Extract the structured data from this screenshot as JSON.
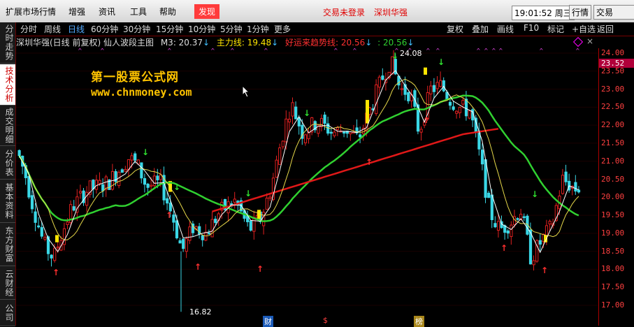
{
  "menubar": {
    "items": [
      "扩展市场行情",
      "增强",
      "资讯",
      "工具",
      "帮助"
    ],
    "active_item": "发现",
    "login_status": "交易未登录",
    "stock_name": "深圳华强",
    "clock": "19:01:52 周三",
    "buttons": [
      "行情",
      "交易"
    ]
  },
  "sidebar": {
    "tabs": [
      "分时走势",
      "技术分析",
      "成交明细",
      "分价表",
      "基本资料",
      "东方财富",
      "云财经",
      "公司"
    ]
  },
  "toolbar": {
    "periods": [
      "分时",
      "周线",
      "日线",
      "60分钟",
      "30分钟",
      "15分钟",
      "10分钟",
      "5分钟",
      "1分钟",
      "更多"
    ],
    "tools": [
      "复权",
      "叠加",
      "画线",
      "F10",
      "标记",
      "+自选",
      "返回"
    ]
  },
  "indicator": {
    "title": "深圳华强(日线 前复权) 仙人波段主图",
    "m3": "M3: 20.37",
    "main": "主力线: 19.48",
    "trend": "好运来趋势线: 20.56",
    "trend2": ": 20.56"
  },
  "watermark": {
    "line1": "第一股票公式网",
    "line2": "www.chnmoney.com"
  },
  "axis": {
    "ticks": [
      "24.00",
      "23.50",
      "23.00",
      "22.50",
      "22.00",
      "21.50",
      "21.00",
      "20.50",
      "20.00",
      "19.50",
      "19.00",
      "18.50",
      "18.00",
      "17.50",
      "17.00"
    ],
    "current_price": "23.52"
  },
  "annotations": {
    "high": "24.08",
    "low": "16.82",
    "markers": [
      "财",
      "$",
      "榜"
    ]
  },
  "colors": {
    "up": "#e02020",
    "down": "#3ad7e6",
    "ma_green": "#30d030",
    "ma_red": "#e01818",
    "ma_yellow": "#e6d84a",
    "highlight": "#ffe500"
  }
}
